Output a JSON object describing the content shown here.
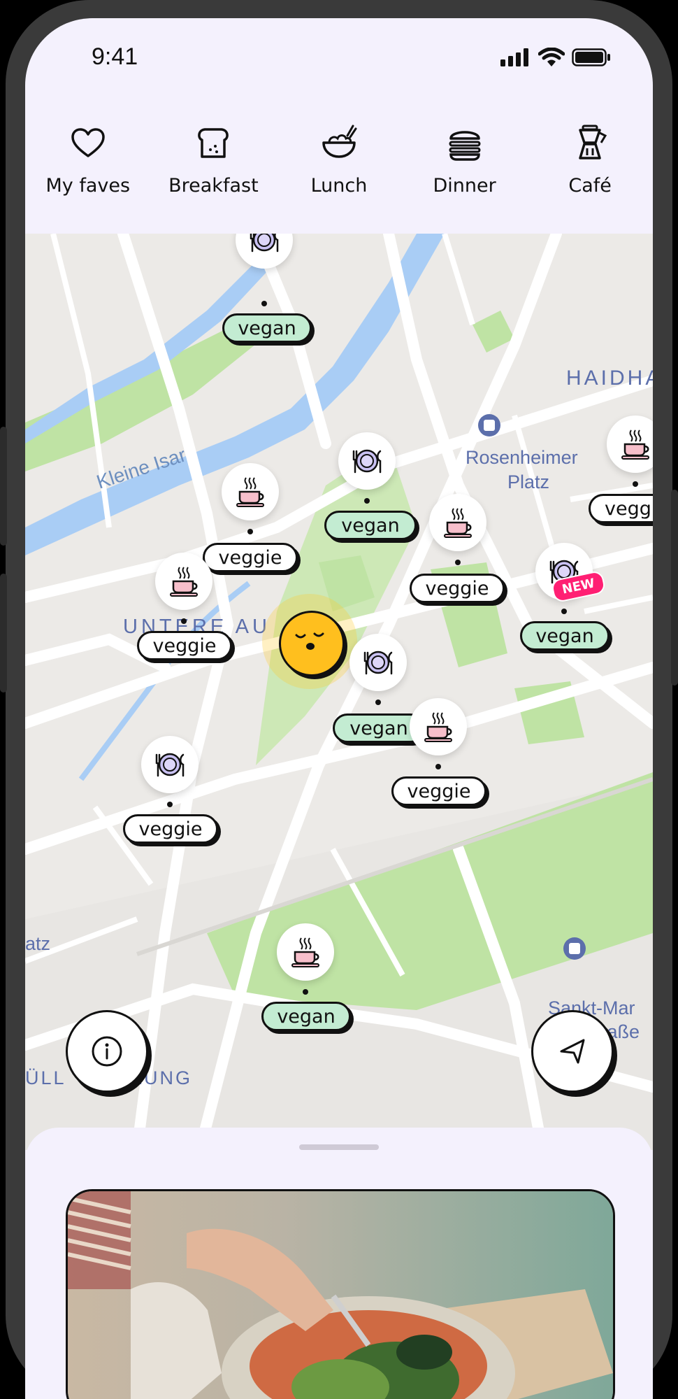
{
  "status_bar": {
    "time": "9:41"
  },
  "categories": [
    {
      "label": "My faves",
      "icon": "heart-icon"
    },
    {
      "label": "Breakfast",
      "icon": "toast-icon"
    },
    {
      "label": "Lunch",
      "icon": "bowl-icon"
    },
    {
      "label": "Dinner",
      "icon": "burger-icon"
    },
    {
      "label": "Café",
      "icon": "moka-pot-icon"
    }
  ],
  "map": {
    "labels": {
      "haidhausen": "HAIDHA",
      "kleine_isar": "Kleine Isar",
      "rosenheimer": "Rosenheimer",
      "platz": "Platz",
      "untere_au": "UNTERE AU",
      "atz": "atz",
      "sankt_mar": "Sankt-Mar",
      "strasse": "Straße",
      "lung": "ÜLL         LUNG"
    },
    "places": [
      {
        "tag": "vegan",
        "icon": "dinner-plate-icon"
      },
      {
        "tag": "veggie",
        "icon": "coffee-cup-icon"
      },
      {
        "tag": "vegan",
        "icon": "dinner-plate-icon"
      },
      {
        "tag": "veggie",
        "icon": "coffee-cup-icon"
      },
      {
        "tag": "vegg",
        "icon": "coffee-cup-icon"
      },
      {
        "tag": "vegan",
        "icon": "dinner-plate-icon",
        "badge": "NEW"
      },
      {
        "tag": "veggie",
        "icon": "coffee-cup-icon"
      },
      {
        "tag": "vegan",
        "icon": "dinner-plate-icon"
      },
      {
        "tag": "veggie",
        "icon": "coffee-cup-icon"
      },
      {
        "tag": "veggie",
        "icon": "dinner-plate-icon"
      },
      {
        "tag": "vegan",
        "icon": "coffee-cup-icon"
      }
    ]
  },
  "colors": {
    "background": "#f4f1fd",
    "vegan_tag": "#c3ecd2",
    "new_badge": "#ff1f73",
    "user_marker": "#ffbf1e",
    "park": "#bfe3a4",
    "water": "#a9cdf5"
  }
}
